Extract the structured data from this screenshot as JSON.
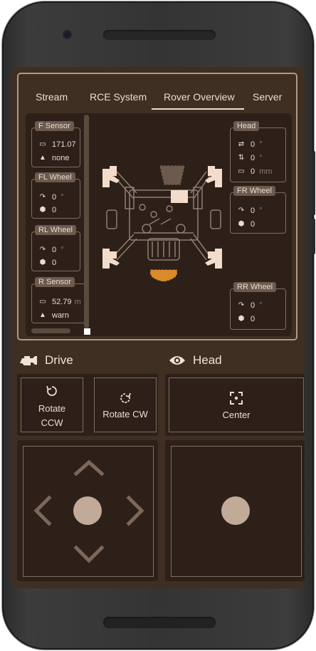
{
  "tabs": [
    {
      "label": "Stream"
    },
    {
      "label": "RCE System"
    },
    {
      "label": "Rover Overview",
      "active": true
    },
    {
      "label": "Server"
    }
  ],
  "sensors": {
    "f_sensor": {
      "title": "F Sensor",
      "distance": "171.07",
      "status": "none"
    },
    "fl_wheel": {
      "title": "FL Wheel",
      "angle": "0",
      "angle_unit": "°",
      "speed": "0"
    },
    "rl_wheel": {
      "title": "RL Wheel",
      "angle": "0",
      "angle_unit": "°",
      "speed": "0"
    },
    "r_sensor": {
      "title": "R Sensor",
      "distance": "52.79",
      "distance_unit": "m",
      "status": "warn"
    },
    "head": {
      "title": "Head",
      "pan": "0",
      "pan_unit": "°",
      "tilt": "0",
      "tilt_unit": "°",
      "distance": "0",
      "distance_unit": "mm"
    },
    "fr_wheel": {
      "title": "FR Wheel",
      "angle": "0",
      "angle_unit": "°",
      "speed": "0"
    },
    "rr_wheel": {
      "title": "RR Wheel",
      "angle": "0",
      "angle_unit": "°",
      "speed": "0"
    }
  },
  "drive": {
    "title": "Drive",
    "rotate_ccw_line1": "Rotate",
    "rotate_ccw_line2": "CCW",
    "rotate_cw": "Rotate CW"
  },
  "head_controls": {
    "title": "Head",
    "center": "Center"
  },
  "colors": {
    "background": "#3f2e22",
    "panel": "#2d2018",
    "accent": "#d98a2b",
    "text": "#e8ddd4"
  }
}
